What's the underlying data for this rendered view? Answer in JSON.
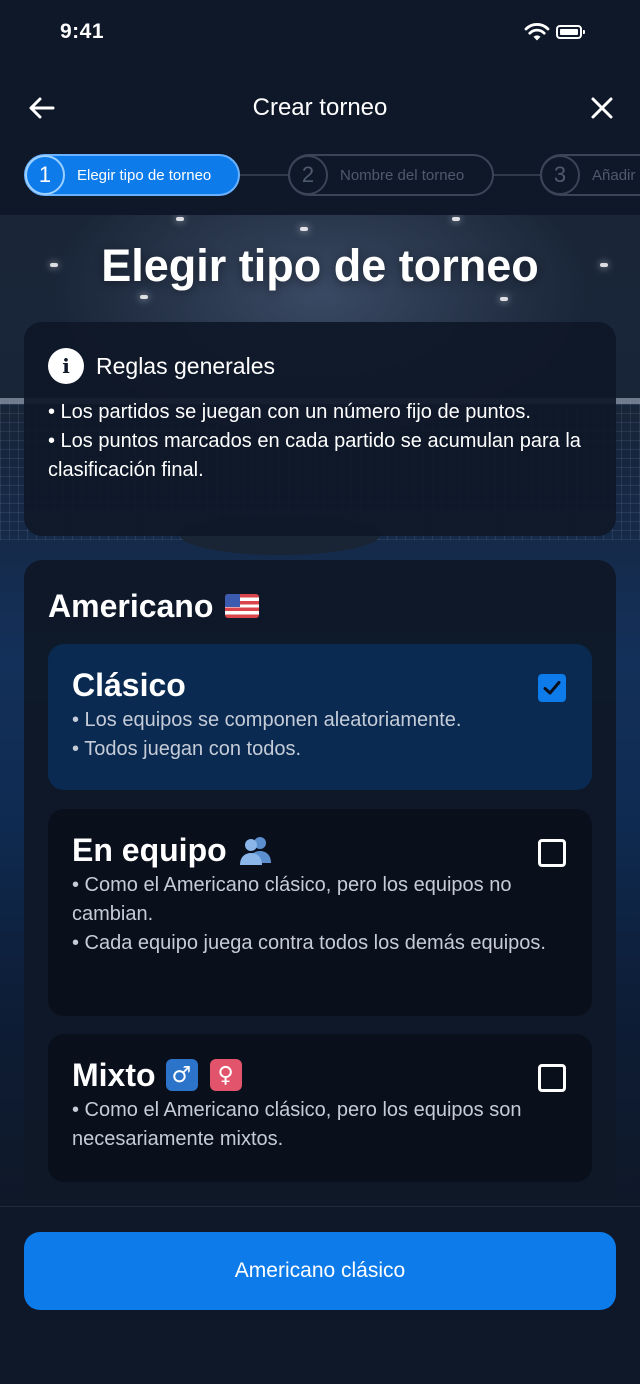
{
  "status_bar": {
    "time": "9:41"
  },
  "header": {
    "title": "Crear torneo"
  },
  "stepper": {
    "steps": [
      {
        "number": "1",
        "label": "Elegir tipo de torneo"
      },
      {
        "number": "2",
        "label": "Nombre del torneo"
      },
      {
        "number": "3",
        "label": "Añadir"
      }
    ]
  },
  "page_title": "Elegir tipo de torneo",
  "rules": {
    "title": "Reglas generales",
    "items": [
      "• Los partidos se juegan con un número fijo de puntos.",
      "• Los puntos marcados en cada partido se acumulan para la clasificación final."
    ]
  },
  "americano": {
    "title": "Americano",
    "options": [
      {
        "title": "Clásico",
        "checked": true,
        "lines": [
          "• Los equipos se componen aleatoriamente.",
          "• Todos juegan con todos."
        ]
      },
      {
        "title": "En equipo",
        "checked": false,
        "lines": [
          "• Como el Americano clásico, pero los equipos no cambian.",
          "• Cada equipo juega contra todos los demás equipos."
        ]
      },
      {
        "title": "Mixto",
        "checked": false,
        "lines": [
          "• Como el Americano clásico, pero los equipos son necesariamente mixtos."
        ]
      }
    ]
  },
  "icons": {
    "male": "♂",
    "female": "♀"
  },
  "primary_button": {
    "label": "Americano clásico"
  },
  "colors": {
    "accent": "#0d7bea",
    "background": "#0f1828",
    "selected_option": "#0a2a52"
  }
}
